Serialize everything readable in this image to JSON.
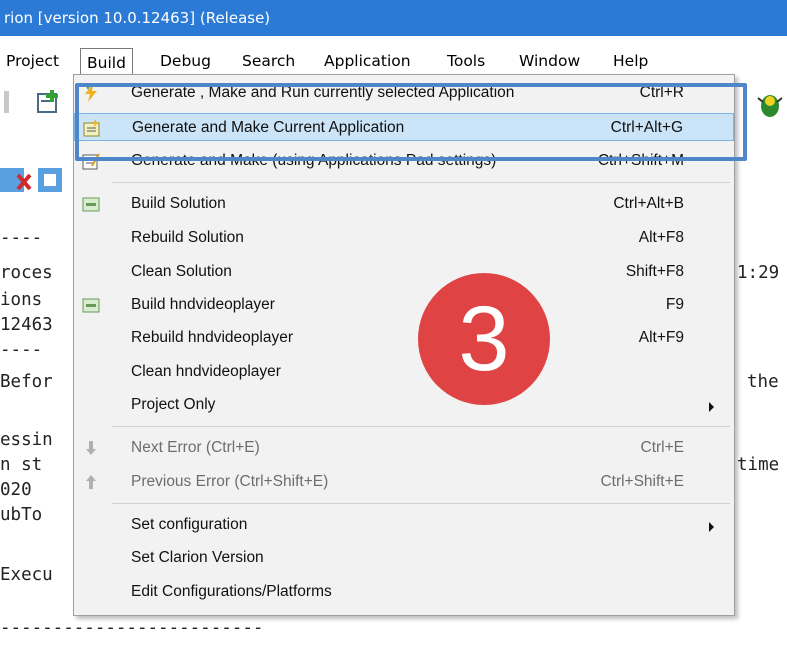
{
  "window": {
    "title": "rion [version 10.0.12463] (Release)"
  },
  "menubar": {
    "items": [
      "Project",
      "Build",
      "Debug",
      "Search",
      "Application",
      "Tools",
      "Window",
      "Help"
    ]
  },
  "editor": {
    "lines": [
      "----",
      "roces",
      "ions",
      "12463",
      "----",
      "Befor",
      "essin",
      "n st",
      "020",
      "ubTo",
      "Execu",
      "-------------------------",
      "1:29",
      "the",
      "time"
    ]
  },
  "build_menu": {
    "items": [
      {
        "label": "Generate , Make and Run currently selected Application",
        "shortcut": "Ctrl+R"
      },
      {
        "label": "Generate and Make Current Application",
        "shortcut": "Ctrl+Alt+G"
      },
      {
        "label": "Generate and Make (using Applications Pad settings)",
        "shortcut": "Ctrl+Shift+M"
      },
      {
        "label": "Build Solution",
        "shortcut": "Ctrl+Alt+B"
      },
      {
        "label": "Rebuild Solution",
        "shortcut": "Alt+F8"
      },
      {
        "label": "Clean Solution",
        "shortcut": "Shift+F8"
      },
      {
        "label": "Build hndvideoplayer",
        "shortcut": "F9"
      },
      {
        "label": "Rebuild hndvideoplayer",
        "shortcut": "Alt+F9"
      },
      {
        "label": "Clean hndvideoplayer",
        "shortcut": ""
      },
      {
        "label": "Project Only",
        "shortcut": ""
      },
      {
        "label": "Next Error (Ctrl+E)",
        "shortcut": "Ctrl+E"
      },
      {
        "label": "Previous Error (Ctrl+Shift+E)",
        "shortcut": "Ctrl+Shift+E"
      },
      {
        "label": "Set configuration",
        "shortcut": ""
      },
      {
        "label": "Set Clarion Version",
        "shortcut": ""
      },
      {
        "label": "Edit Configurations/Platforms",
        "shortcut": ""
      }
    ]
  },
  "annotation": {
    "step_number": "3"
  },
  "colors": {
    "title_bar": "#2b7ad6",
    "highlight": "#cce4f7",
    "callout_border": "#4e87c9",
    "badge": "#e04343"
  }
}
